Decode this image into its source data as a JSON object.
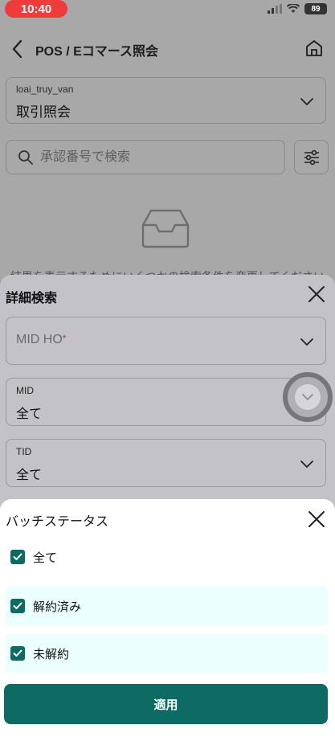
{
  "status_bar": {
    "time": "10:40",
    "battery": "89"
  },
  "header": {
    "title": "POS / Eコマース照会",
    "back_icon": "chevron-left-icon",
    "home_icon": "home-icon"
  },
  "query_type": {
    "label": "loai_truy_van",
    "value": "取引照会"
  },
  "search": {
    "placeholder": "承認番号で検索"
  },
  "empty_state": {
    "text": "結果を表示するためにいくつかの検索条件を変更してください"
  },
  "advanced_search": {
    "title": "詳細検索",
    "fields": [
      {
        "placeholder": "MID HO",
        "required_mark": "*"
      },
      {
        "label": "MID",
        "value": "全て"
      },
      {
        "label": "TID",
        "value": "全て"
      }
    ]
  },
  "batch_status": {
    "title": "バッチステータス",
    "options": [
      {
        "label": "全て",
        "checked": true
      },
      {
        "label": "解約済み",
        "checked": true
      },
      {
        "label": "未解約",
        "checked": true
      }
    ],
    "apply_label": "適用"
  },
  "colors": {
    "primary": "#0d6b63",
    "highlight": "#eafffe",
    "status_pill": "#ef3b3b",
    "overlay": "#a8a8a8"
  }
}
